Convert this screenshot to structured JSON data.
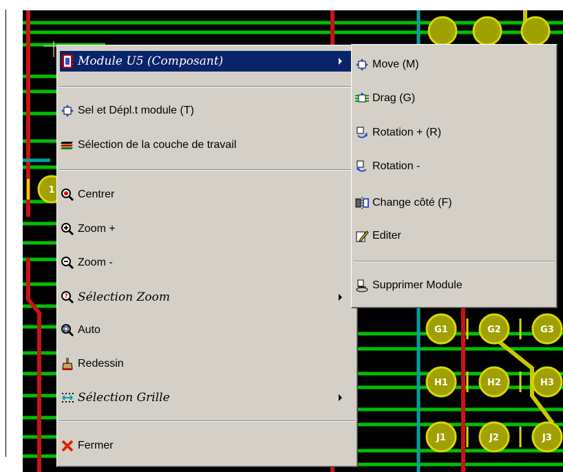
{
  "colors": {
    "menu_bg": "#d4d0c8",
    "highlight": "#0a246a",
    "pcb_bg": "#000000",
    "track_green": "#00c000",
    "track_red": "#c81414",
    "track_cyan": "#00a0a0",
    "pad_yellow": "#c8c800"
  },
  "board": {
    "pad_labels": [
      "G1",
      "G2",
      "G3",
      "H1",
      "H2",
      "H3",
      "J1",
      "J2",
      "J3",
      "1"
    ]
  },
  "context_menu": {
    "header": {
      "label": "Module U5 (Composant)",
      "icon": "module-chip-icon"
    },
    "items": [
      {
        "label": "Sel et Dépl.t module (T)",
        "icon": "move-module-icon"
      },
      {
        "label": "Sélection de la couche de travail",
        "icon": "layers-icon"
      },
      {
        "label": "Centrer",
        "icon": "center-zoom-icon"
      },
      {
        "label": "Zoom +",
        "icon": "zoom-in-icon"
      },
      {
        "label": "Zoom -",
        "icon": "zoom-out-icon"
      },
      {
        "label": "Sélection Zoom",
        "icon": "zoom-select-icon"
      },
      {
        "label": "Auto",
        "icon": "zoom-auto-icon"
      },
      {
        "label": "Redessin",
        "icon": "redraw-brush-icon"
      },
      {
        "label": "Sélection Grille",
        "icon": "grid-icon"
      },
      {
        "label": "Fermer",
        "icon": "close-x-icon"
      }
    ]
  },
  "submenu": {
    "items": [
      {
        "label": "Move (M)",
        "icon": "move-icon"
      },
      {
        "label": "Drag (G)",
        "icon": "drag-icon"
      },
      {
        "label": "Rotation + (R)",
        "icon": "rotate-plus-icon"
      },
      {
        "label": "Rotation -",
        "icon": "rotate-minus-icon"
      },
      {
        "label": "Change côté (F)",
        "icon": "flip-side-icon"
      },
      {
        "label": "Editer",
        "icon": "edit-pencil-icon"
      },
      {
        "label": "Supprimer Module",
        "icon": "delete-module-icon"
      }
    ]
  }
}
